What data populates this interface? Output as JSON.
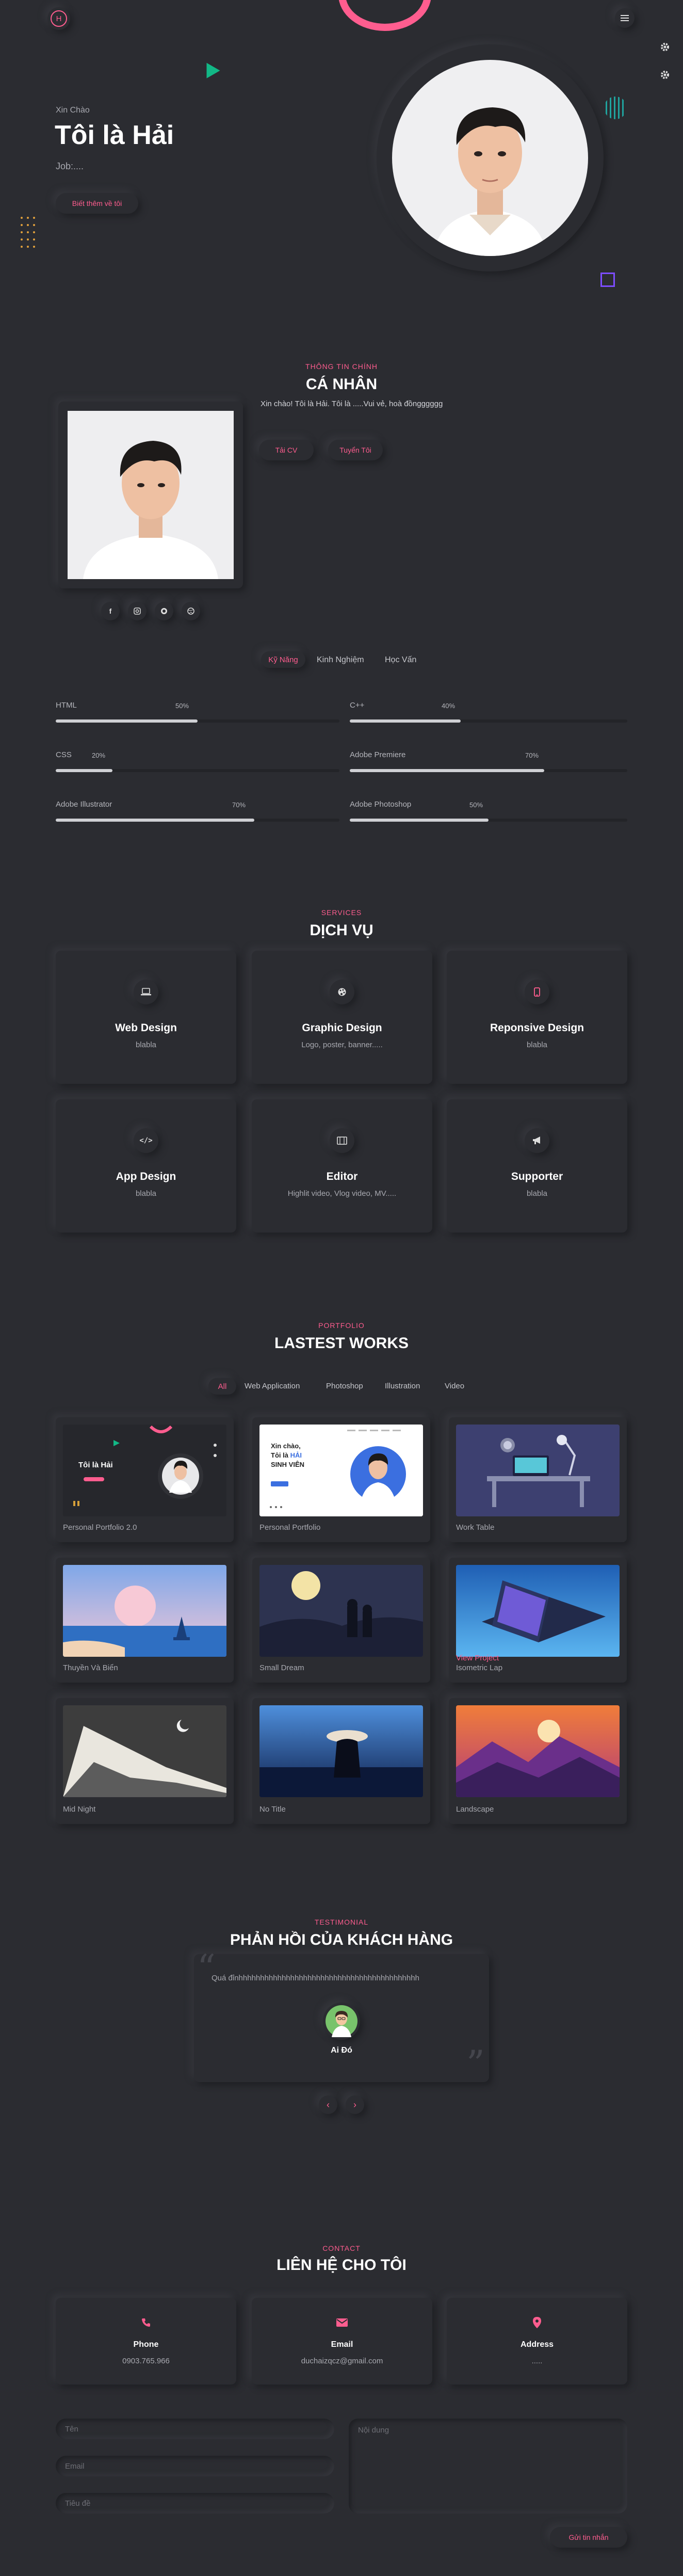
{
  "header": {
    "logo_letter": "H",
    "menu_icon": "hamburger-icon",
    "settings_icons": [
      "gear-icon",
      "gear-icon"
    ]
  },
  "hero": {
    "greeting": "Xin Chào",
    "name": "Tôi là Hải",
    "job": "Job:....",
    "cta_label": "Biết thêm về tôi"
  },
  "about": {
    "subtitle": "THÔNG TIN CHÍNH",
    "title": "CÁ NHÂN",
    "intro": "Xin chào! Tôi là Hải. Tôi là .....Vui vẻ, hoà đồngggggg",
    "cv_button": "Tải CV",
    "recruit_button": "Tuyển Tôi",
    "socials": [
      "facebook-icon",
      "instagram-icon",
      "github-icon",
      "dribbble-icon"
    ],
    "tabs": [
      "Kỹ Năng",
      "Kinh Nghiệm",
      "Học Vấn"
    ],
    "active_tab": "Kỹ Năng",
    "skills": [
      {
        "name": "HTML",
        "percent_label": "50%",
        "value": 50
      },
      {
        "name": "C++",
        "percent_label": "40%",
        "value": 40
      },
      {
        "name": "CSS",
        "percent_label": "20%",
        "value": 20
      },
      {
        "name": "Adobe Premiere",
        "percent_label": "70%",
        "value": 70
      },
      {
        "name": "Adobe Illustrator",
        "percent_label": "70%",
        "value": 70
      },
      {
        "name": "Adobe Photoshop",
        "percent_label": "50%",
        "value": 50
      }
    ]
  },
  "services": {
    "subtitle": "SERVICES",
    "title": "DỊCH VỤ",
    "items": [
      {
        "title": "Web Design",
        "desc": "blabla",
        "icon": "laptop-icon"
      },
      {
        "title": "Graphic Design",
        "desc": "Logo, poster, banner.....",
        "icon": "palette-icon"
      },
      {
        "title": "Reponsive Design",
        "desc": "blabla",
        "icon": "mobile-icon"
      },
      {
        "title": "App Design",
        "desc": "blabla",
        "icon": "code-icon"
      },
      {
        "title": "Editor",
        "desc": "Highlit video, Vlog video, MV.....",
        "icon": "film-icon"
      },
      {
        "title": "Supporter",
        "desc": "blabla",
        "icon": "megaphone-icon"
      }
    ]
  },
  "portfolio": {
    "subtitle": "PORTFOLIO",
    "title": "LASTEST WORKS",
    "filters": [
      "All",
      "Web Application",
      "Photoshop",
      "Illustration",
      "Video"
    ],
    "active_filter": "All",
    "works": [
      {
        "name": "Personal Portfolio 2.0"
      },
      {
        "name": "Personal Portfolio"
      },
      {
        "name": "Work Table"
      },
      {
        "name": "Thuyền Và Biển"
      },
      {
        "name": "Small Dream"
      },
      {
        "name": "Isometric Lap",
        "hover_label": "View Project"
      },
      {
        "name": "Mid Night"
      },
      {
        "name": "No Title"
      },
      {
        "name": "Landscape"
      }
    ],
    "thumb_text": {
      "p1_title": "Tôi là Hải",
      "p2_line1": "Xin chào,",
      "p2_line2": "Tôi là",
      "p2_highlight": "HẢI",
      "p2_line3": "SINH VIÊN"
    }
  },
  "testimonial": {
    "subtitle": "TESTIMONIAL",
    "title": "PHẢN HỒI CỦA KHÁCH HÀNG",
    "quote": "Quá đỉnhhhhhhhhhhhhhhhhhhhhhhhhhhhhhhhhhhhhhhhhhh",
    "author": "Ai Đó"
  },
  "contact": {
    "subtitle": "CONTACT",
    "title": "LIÊN HỆ CHO TÔI",
    "cards": [
      {
        "label": "Phone",
        "value": "0903.765.966",
        "icon": "phone-icon"
      },
      {
        "label": "Email",
        "value": "duchaizqcz@gmail.com",
        "icon": "envelope-icon"
      },
      {
        "label": "Address",
        "value": ".....",
        "icon": "map-pin-icon"
      }
    ],
    "form": {
      "name_placeholder": "Tên",
      "email_placeholder": "Email",
      "subject_placeholder": "Tiêu đề",
      "message_placeholder": "Nội dung",
      "submit_label": "Gửi tin nhắn"
    }
  },
  "colors": {
    "background": "#2b2c31",
    "accent": "#ff5d8f",
    "text": "#ffffff"
  }
}
